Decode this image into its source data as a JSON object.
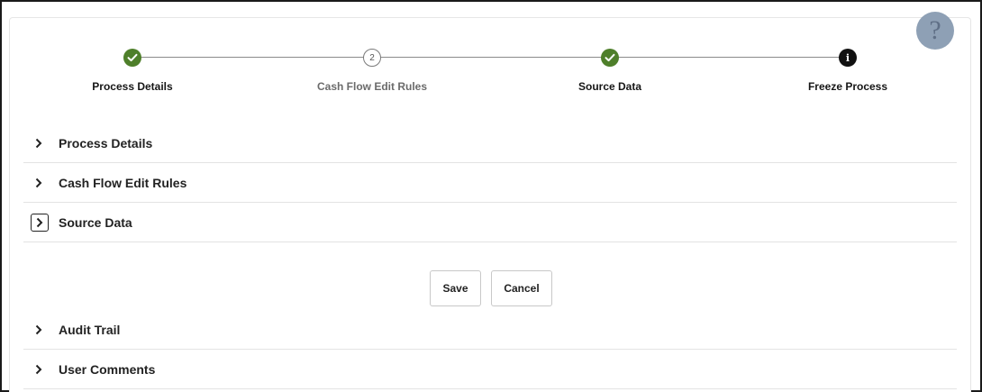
{
  "help": {
    "label": "?"
  },
  "steps": [
    {
      "label": "Process Details",
      "state": "done"
    },
    {
      "label": "Cash Flow Edit Rules",
      "state": "current",
      "number": "2"
    },
    {
      "label": "Source Data",
      "state": "done"
    },
    {
      "label": "Freeze Process",
      "state": "info",
      "glyph": "i"
    }
  ],
  "sections": {
    "process_details": "Process Details",
    "cash_flow_edit_rules": "Cash Flow Edit Rules",
    "source_data": "Source Data"
  },
  "buttons": {
    "save": "Save",
    "cancel": "Cancel"
  },
  "footer_sections": {
    "audit_trail": "Audit Trail",
    "user_comments": "User Comments"
  },
  "colors": {
    "done": "#4e7f2a",
    "info": "#111111",
    "help_badge": "#8ea0b5"
  }
}
